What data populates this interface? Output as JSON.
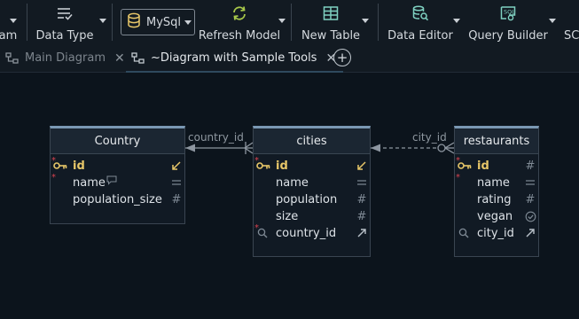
{
  "toolbar": {
    "partial_left_label": "am",
    "data_type_label": "Data Type",
    "db_select_value": "MySql",
    "refresh_label": "Refresh Model",
    "new_table_label": "New Table",
    "data_editor_label": "Data Editor",
    "query_builder_label": "Query Builder",
    "partial_right_label": "SC"
  },
  "tabs": [
    {
      "label": "Main Diagram",
      "active": false
    },
    {
      "label": "~Diagram with Sample Tools",
      "active": true
    }
  ],
  "diagram": {
    "tables": {
      "country": {
        "title": "Country",
        "columns": [
          {
            "name": "id"
          },
          {
            "name": "name"
          },
          {
            "name": "population_size"
          }
        ]
      },
      "cities": {
        "title": "cities",
        "columns": [
          {
            "name": "id"
          },
          {
            "name": "name"
          },
          {
            "name": "population"
          },
          {
            "name": "size"
          },
          {
            "name": "country_id"
          }
        ]
      },
      "restaurants": {
        "title": "restaurants",
        "columns": [
          {
            "name": "id"
          },
          {
            "name": "name"
          },
          {
            "name": "rating"
          },
          {
            "name": "vegan"
          },
          {
            "name": "city_id"
          }
        ]
      }
    },
    "relations": [
      {
        "label": "country_id",
        "from": "cities",
        "to": "Country"
      },
      {
        "label": "city_id",
        "from": "restaurants",
        "to": "cities"
      }
    ]
  },
  "colors": {
    "background": "#0c141c",
    "toolbar": "#121a22",
    "primary_key": "#e8c769",
    "mandatory_star": "#d6414e",
    "table_header_accent": "#7a98b3",
    "icon_green": "#a8c84a",
    "icon_teal": "#7fd1c1"
  },
  "icons": [
    "database-icon",
    "refresh-icon",
    "table-icon",
    "data-editor-icon",
    "query-builder-icon",
    "diagram-tab-icon",
    "key-icon",
    "comment-icon",
    "index-search-icon",
    "fk-arrow-icon",
    "pk-arrow-icon",
    "text-type-icon",
    "number-type-icon",
    "boolean-check-icon"
  ]
}
